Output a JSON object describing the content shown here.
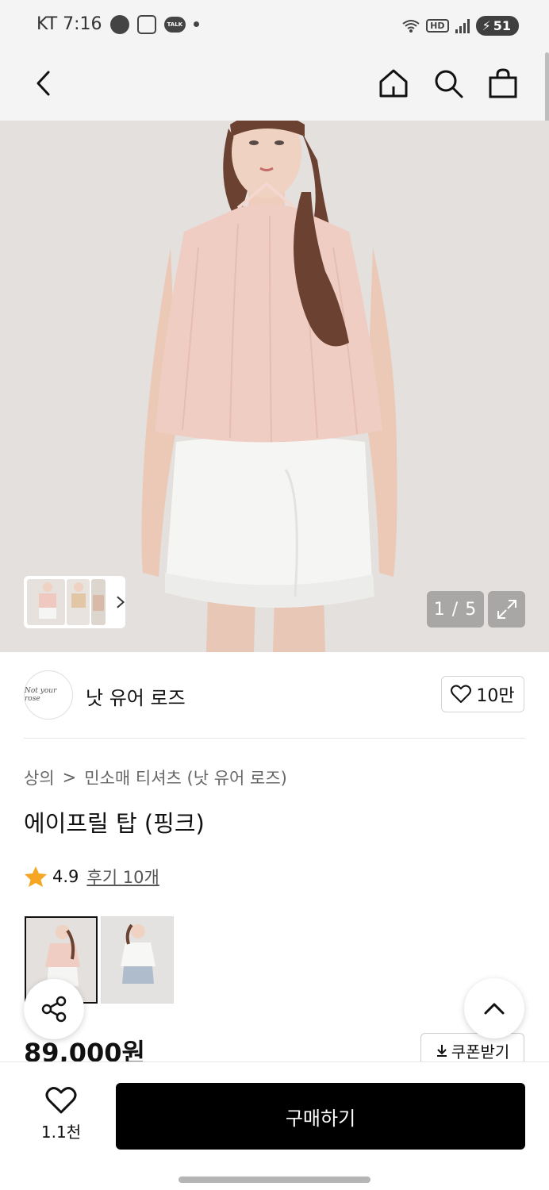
{
  "status_bar": {
    "carrier_time": "KT 7:16",
    "talk": "TALK",
    "hd": "HD",
    "battery": "51"
  },
  "nav": {
    "icons": [
      "back-icon",
      "home-icon",
      "search-icon",
      "bag-icon"
    ]
  },
  "gallery": {
    "counter": "1 / 5"
  },
  "brand": {
    "logo_text": "Not your rose",
    "name": "낫 유어 로즈",
    "likes": "10만"
  },
  "breadcrumb": {
    "category": "상의",
    "separator": ">",
    "subcategory": "민소매 티셔츠 (낫 유어 로즈)"
  },
  "product": {
    "title": "에이프릴 탑 (핑크)",
    "rating": "4.9",
    "reviews": "후기 10개",
    "price": "89,000원"
  },
  "actions": {
    "coupon": "쿠폰받기",
    "wishlist_count": "1.1천",
    "buy": "구매하기"
  },
  "colors": {
    "accent_star": "#f5a623",
    "buy_button": "#000000"
  }
}
